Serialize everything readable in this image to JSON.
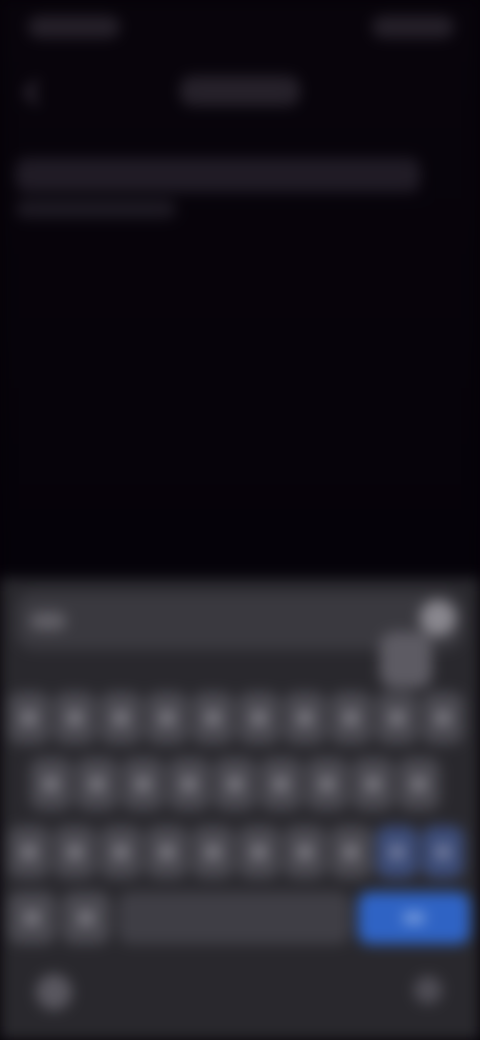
{
  "theme": {
    "background": "#050207",
    "keyboard_background": "#29282d",
    "key_color": "#4a4950",
    "accent": "#2f63c4"
  },
  "status_bar": {
    "icons": [
      "time-indicator",
      "battery-icon"
    ]
  },
  "header": {
    "icons": [
      "back-arrow-icon"
    ]
  },
  "keyboard": {
    "icons": [
      "emoji-icon",
      "send-icon",
      "keyboard-hide-icon",
      "microphone-icon"
    ]
  }
}
